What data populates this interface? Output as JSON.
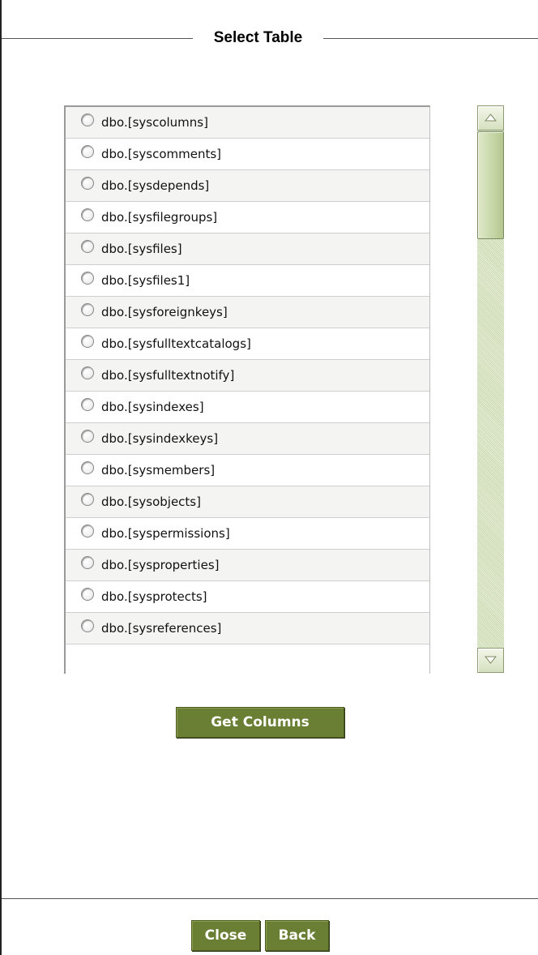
{
  "panel": {
    "title": "Select Table"
  },
  "table_list": {
    "items": [
      "dbo.[syscolumns]",
      "dbo.[syscomments]",
      "dbo.[sysdepends]",
      "dbo.[sysfilegroups]",
      "dbo.[sysfiles]",
      "dbo.[sysfiles1]",
      "dbo.[sysforeignkeys]",
      "dbo.[sysfulltextcatalogs]",
      "dbo.[sysfulltextnotify]",
      "dbo.[sysindexes]",
      "dbo.[sysindexkeys]",
      "dbo.[sysmembers]",
      "dbo.[sysobjects]",
      "dbo.[syspermissions]",
      "dbo.[sysproperties]",
      "dbo.[sysprotects]",
      "dbo.[sysreferences]"
    ],
    "selected_index": null
  },
  "buttons": {
    "get_columns": "Get Columns",
    "close": "Close",
    "back": "Back"
  },
  "colors": {
    "button_bg": "#6a7f34",
    "scrollbar_track": "#d8e3c4",
    "row_alt": "#f4f4f2"
  },
  "icons": {
    "scroll_up": "triangle-up-icon",
    "scroll_down": "triangle-down-icon",
    "radio": "radio-unchecked-icon"
  }
}
